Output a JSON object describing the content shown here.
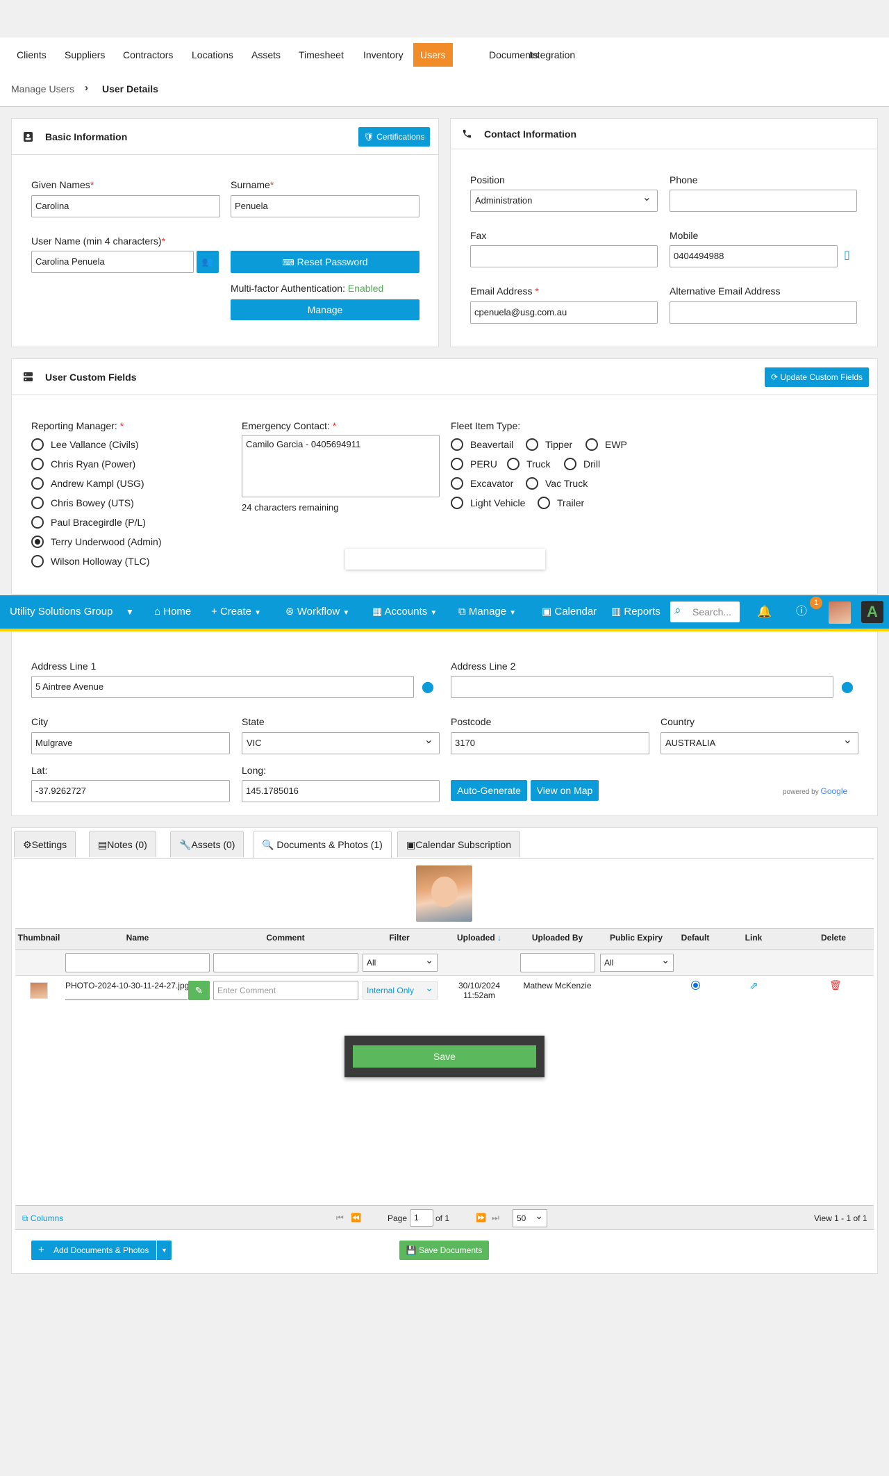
{
  "menu": {
    "items": [
      "Clients",
      "Suppliers",
      "Contractors",
      "Locations",
      "Assets",
      "Timesheet",
      "Inventory",
      "Users",
      "Documents",
      "Integration"
    ],
    "active": "Users"
  },
  "breadcrumb": {
    "parent": "Manage Users",
    "current": "User Details"
  },
  "basic": {
    "title": "Basic Information",
    "cert_button": "Certifications",
    "given_label": "Given Names",
    "given_value": "Carolina",
    "surname_label": "Surname",
    "surname_value": "Penuela",
    "username_label": "User Name (min 4 characters)",
    "username_value": "Carolina Penuela",
    "reset_button": "Reset Password",
    "mfa_label": "Multi-factor Authentication:",
    "mfa_status": "Enabled",
    "manage_button": "Manage"
  },
  "contact": {
    "title": "Contact Information",
    "position_label": "Position",
    "position_value": "Administration",
    "phone_label": "Phone",
    "phone_value": "",
    "fax_label": "Fax",
    "fax_value": "",
    "mobile_label": "Mobile",
    "mobile_value": "0404494988",
    "email_label": "Email Address",
    "email_value": "cpenuela@usg.com.au",
    "alt_email_label": "Alternative Email Address",
    "alt_email_value": ""
  },
  "custom": {
    "title": "User Custom Fields",
    "update_button": "Update Custom Fields",
    "manager_label": "Reporting Manager:",
    "managers": [
      {
        "name": "Lee Vallance (Civils)",
        "selected": false
      },
      {
        "name": "Chris Ryan (Power)",
        "selected": false
      },
      {
        "name": "Andrew Kampl (USG)",
        "selected": false
      },
      {
        "name": "Chris Bowey (UTS)",
        "selected": false
      },
      {
        "name": "Paul Bracegirdle (P/L)",
        "selected": false
      },
      {
        "name": "Terry Underwood (Admin)",
        "selected": true
      },
      {
        "name": "Wilson Holloway (TLC)",
        "selected": false
      }
    ],
    "emergency_label": "Emergency Contact:",
    "emergency_value": "Camilo Garcia - 0405694911",
    "emergency_remaining": "24 characters remaining",
    "fleet_label": "Fleet Item Type:",
    "fleet": [
      "Beavertail",
      "Tipper",
      "EWP",
      "PERU",
      "Truck",
      "Drill",
      "Excavator",
      "Vac Truck",
      "Light Vehicle",
      "Trailer"
    ]
  },
  "topnav": {
    "company": "Utility Solutions Group",
    "home": "Home",
    "create": "Create",
    "workflow": "Workflow",
    "accounts": "Accounts",
    "manage": "Manage",
    "calendar": "Calendar",
    "reports": "Reports",
    "search_placeholder": "Search...",
    "help_badge": "1"
  },
  "address": {
    "line1_label": "Address Line 1",
    "line1_value": "5 Aintree Avenue",
    "line2_label": "Address Line 2",
    "line2_value": "",
    "city_label": "City",
    "city_value": "Mulgrave",
    "state_label": "State",
    "state_value": "VIC",
    "postcode_label": "Postcode",
    "postcode_value": "3170",
    "country_label": "Country",
    "country_value": "AUSTRALIA",
    "lat_label": "Lat:",
    "lat_value": "-37.9262727",
    "long_label": "Long:",
    "long_value": "145.1785016",
    "autogen_button": "Auto-Generate",
    "viewmap_button": "View on Map",
    "powered_by": "powered by",
    "google": "Google"
  },
  "tabs": [
    "Settings",
    "Notes (0)",
    "Assets (0)",
    "Documents & Photos (1)",
    "Calendar Subscription"
  ],
  "docs": {
    "headers": [
      "Thumbnail",
      "Name",
      "Comment",
      "Filter",
      "Uploaded",
      "Uploaded By",
      "Public Expiry",
      "Default",
      "Link",
      "Delete"
    ],
    "filter_all": "All",
    "expiry_all": "All",
    "row": {
      "name": "PHOTO-2024-10-30-11-24-27.jpg",
      "comment_placeholder": "Enter Comment",
      "filter": "Internal Only",
      "uploaded_date": "30/10/2024",
      "uploaded_time": "11:52am",
      "uploaded_by": "Mathew McKenzie"
    },
    "save_button": "Save",
    "columns_link": "Columns",
    "page_label": "Page",
    "page_value": "1",
    "of_label": "of 1",
    "page_size": "50",
    "view_info": "View 1 - 1 of 1",
    "add_button": "Add Documents & Photos",
    "save_docs_button": "Save Documents"
  },
  "colors": {
    "accent": "#0a9bd8",
    "menu_active": "#f28c28",
    "success": "#5cb85c",
    "required": "#e53935"
  }
}
